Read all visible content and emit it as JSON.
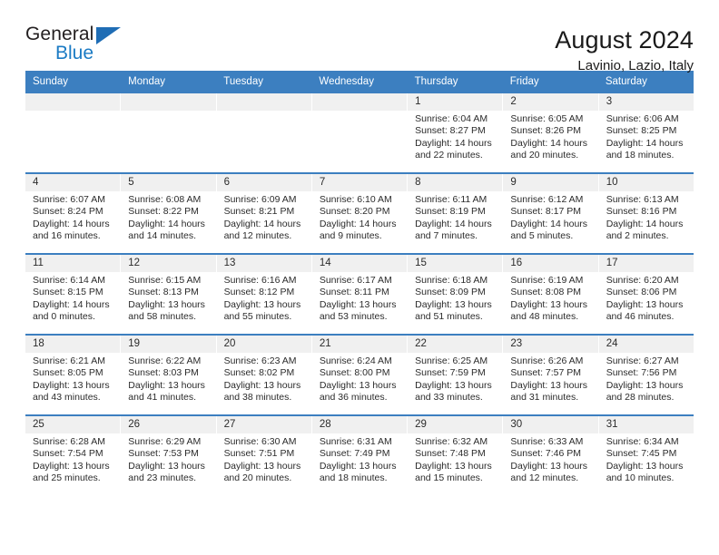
{
  "brand": {
    "name_part1": "General",
    "name_part2": "Blue",
    "accent_color": "#1b7bc4",
    "triangle_color": "#1f6db5"
  },
  "header": {
    "title": "August 2024",
    "location": "Lavinio, Lazio, Italy",
    "header_bg": "#3c7fc0",
    "daynum_bg": "#f0f0f0"
  },
  "weekdays": [
    "Sunday",
    "Monday",
    "Tuesday",
    "Wednesday",
    "Thursday",
    "Friday",
    "Saturday"
  ],
  "weeks": [
    [
      {
        "day": "",
        "sunrise": "",
        "sunset": "",
        "daylight1": "",
        "daylight2": "",
        "empty": true
      },
      {
        "day": "",
        "sunrise": "",
        "sunset": "",
        "daylight1": "",
        "daylight2": "",
        "empty": true
      },
      {
        "day": "",
        "sunrise": "",
        "sunset": "",
        "daylight1": "",
        "daylight2": "",
        "empty": true
      },
      {
        "day": "",
        "sunrise": "",
        "sunset": "",
        "daylight1": "",
        "daylight2": "",
        "empty": true
      },
      {
        "day": "1",
        "sunrise": "Sunrise: 6:04 AM",
        "sunset": "Sunset: 8:27 PM",
        "daylight1": "Daylight: 14 hours",
        "daylight2": "and 22 minutes."
      },
      {
        "day": "2",
        "sunrise": "Sunrise: 6:05 AM",
        "sunset": "Sunset: 8:26 PM",
        "daylight1": "Daylight: 14 hours",
        "daylight2": "and 20 minutes."
      },
      {
        "day": "3",
        "sunrise": "Sunrise: 6:06 AM",
        "sunset": "Sunset: 8:25 PM",
        "daylight1": "Daylight: 14 hours",
        "daylight2": "and 18 minutes."
      }
    ],
    [
      {
        "day": "4",
        "sunrise": "Sunrise: 6:07 AM",
        "sunset": "Sunset: 8:24 PM",
        "daylight1": "Daylight: 14 hours",
        "daylight2": "and 16 minutes."
      },
      {
        "day": "5",
        "sunrise": "Sunrise: 6:08 AM",
        "sunset": "Sunset: 8:22 PM",
        "daylight1": "Daylight: 14 hours",
        "daylight2": "and 14 minutes."
      },
      {
        "day": "6",
        "sunrise": "Sunrise: 6:09 AM",
        "sunset": "Sunset: 8:21 PM",
        "daylight1": "Daylight: 14 hours",
        "daylight2": "and 12 minutes."
      },
      {
        "day": "7",
        "sunrise": "Sunrise: 6:10 AM",
        "sunset": "Sunset: 8:20 PM",
        "daylight1": "Daylight: 14 hours",
        "daylight2": "and 9 minutes."
      },
      {
        "day": "8",
        "sunrise": "Sunrise: 6:11 AM",
        "sunset": "Sunset: 8:19 PM",
        "daylight1": "Daylight: 14 hours",
        "daylight2": "and 7 minutes."
      },
      {
        "day": "9",
        "sunrise": "Sunrise: 6:12 AM",
        "sunset": "Sunset: 8:17 PM",
        "daylight1": "Daylight: 14 hours",
        "daylight2": "and 5 minutes."
      },
      {
        "day": "10",
        "sunrise": "Sunrise: 6:13 AM",
        "sunset": "Sunset: 8:16 PM",
        "daylight1": "Daylight: 14 hours",
        "daylight2": "and 2 minutes."
      }
    ],
    [
      {
        "day": "11",
        "sunrise": "Sunrise: 6:14 AM",
        "sunset": "Sunset: 8:15 PM",
        "daylight1": "Daylight: 14 hours",
        "daylight2": "and 0 minutes."
      },
      {
        "day": "12",
        "sunrise": "Sunrise: 6:15 AM",
        "sunset": "Sunset: 8:13 PM",
        "daylight1": "Daylight: 13 hours",
        "daylight2": "and 58 minutes."
      },
      {
        "day": "13",
        "sunrise": "Sunrise: 6:16 AM",
        "sunset": "Sunset: 8:12 PM",
        "daylight1": "Daylight: 13 hours",
        "daylight2": "and 55 minutes."
      },
      {
        "day": "14",
        "sunrise": "Sunrise: 6:17 AM",
        "sunset": "Sunset: 8:11 PM",
        "daylight1": "Daylight: 13 hours",
        "daylight2": "and 53 minutes."
      },
      {
        "day": "15",
        "sunrise": "Sunrise: 6:18 AM",
        "sunset": "Sunset: 8:09 PM",
        "daylight1": "Daylight: 13 hours",
        "daylight2": "and 51 minutes."
      },
      {
        "day": "16",
        "sunrise": "Sunrise: 6:19 AM",
        "sunset": "Sunset: 8:08 PM",
        "daylight1": "Daylight: 13 hours",
        "daylight2": "and 48 minutes."
      },
      {
        "day": "17",
        "sunrise": "Sunrise: 6:20 AM",
        "sunset": "Sunset: 8:06 PM",
        "daylight1": "Daylight: 13 hours",
        "daylight2": "and 46 minutes."
      }
    ],
    [
      {
        "day": "18",
        "sunrise": "Sunrise: 6:21 AM",
        "sunset": "Sunset: 8:05 PM",
        "daylight1": "Daylight: 13 hours",
        "daylight2": "and 43 minutes."
      },
      {
        "day": "19",
        "sunrise": "Sunrise: 6:22 AM",
        "sunset": "Sunset: 8:03 PM",
        "daylight1": "Daylight: 13 hours",
        "daylight2": "and 41 minutes."
      },
      {
        "day": "20",
        "sunrise": "Sunrise: 6:23 AM",
        "sunset": "Sunset: 8:02 PM",
        "daylight1": "Daylight: 13 hours",
        "daylight2": "and 38 minutes."
      },
      {
        "day": "21",
        "sunrise": "Sunrise: 6:24 AM",
        "sunset": "Sunset: 8:00 PM",
        "daylight1": "Daylight: 13 hours",
        "daylight2": "and 36 minutes."
      },
      {
        "day": "22",
        "sunrise": "Sunrise: 6:25 AM",
        "sunset": "Sunset: 7:59 PM",
        "daylight1": "Daylight: 13 hours",
        "daylight2": "and 33 minutes."
      },
      {
        "day": "23",
        "sunrise": "Sunrise: 6:26 AM",
        "sunset": "Sunset: 7:57 PM",
        "daylight1": "Daylight: 13 hours",
        "daylight2": "and 31 minutes."
      },
      {
        "day": "24",
        "sunrise": "Sunrise: 6:27 AM",
        "sunset": "Sunset: 7:56 PM",
        "daylight1": "Daylight: 13 hours",
        "daylight2": "and 28 minutes."
      }
    ],
    [
      {
        "day": "25",
        "sunrise": "Sunrise: 6:28 AM",
        "sunset": "Sunset: 7:54 PM",
        "daylight1": "Daylight: 13 hours",
        "daylight2": "and 25 minutes."
      },
      {
        "day": "26",
        "sunrise": "Sunrise: 6:29 AM",
        "sunset": "Sunset: 7:53 PM",
        "daylight1": "Daylight: 13 hours",
        "daylight2": "and 23 minutes."
      },
      {
        "day": "27",
        "sunrise": "Sunrise: 6:30 AM",
        "sunset": "Sunset: 7:51 PM",
        "daylight1": "Daylight: 13 hours",
        "daylight2": "and 20 minutes."
      },
      {
        "day": "28",
        "sunrise": "Sunrise: 6:31 AM",
        "sunset": "Sunset: 7:49 PM",
        "daylight1": "Daylight: 13 hours",
        "daylight2": "and 18 minutes."
      },
      {
        "day": "29",
        "sunrise": "Sunrise: 6:32 AM",
        "sunset": "Sunset: 7:48 PM",
        "daylight1": "Daylight: 13 hours",
        "daylight2": "and 15 minutes."
      },
      {
        "day": "30",
        "sunrise": "Sunrise: 6:33 AM",
        "sunset": "Sunset: 7:46 PM",
        "daylight1": "Daylight: 13 hours",
        "daylight2": "and 12 minutes."
      },
      {
        "day": "31",
        "sunrise": "Sunrise: 6:34 AM",
        "sunset": "Sunset: 7:45 PM",
        "daylight1": "Daylight: 13 hours",
        "daylight2": "and 10 minutes."
      }
    ]
  ]
}
